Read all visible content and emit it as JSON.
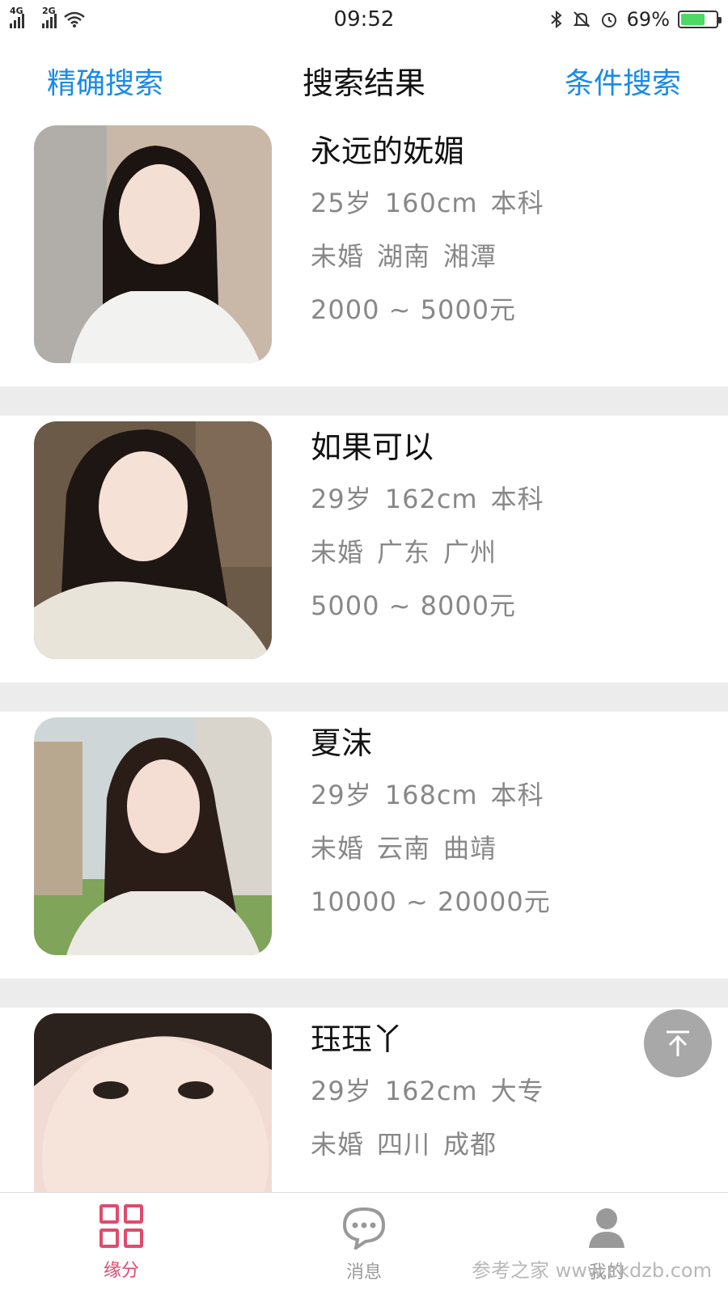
{
  "status_bar": {
    "network1": "4G",
    "network2": "2G",
    "time": "09:52",
    "battery": "69%",
    "battery_level": 0.69
  },
  "nav": {
    "left": "精确搜索",
    "title": "搜索结果",
    "right": "条件搜索"
  },
  "profiles": [
    {
      "name": "永远的妩媚",
      "age": "25岁",
      "height": "160cm",
      "edu": "本科",
      "marital": "未婚",
      "province": "湖南",
      "city": "湘潭",
      "income": "2000 ~ 5000元",
      "photo_bg": "#c9b8a8",
      "hair": "#1b1411",
      "shirt": "#f2f2f0"
    },
    {
      "name": "如果可以",
      "age": "29岁",
      "height": "162cm",
      "edu": "本科",
      "marital": "未婚",
      "province": "广东",
      "city": "广州",
      "income": "5000 ~ 8000元",
      "photo_bg": "#6b5a48",
      "hair": "#1e1612",
      "shirt": "#e9e4da"
    },
    {
      "name": "夏沫",
      "age": "29岁",
      "height": "168cm",
      "edu": "本科",
      "marital": "未婚",
      "province": "云南",
      "city": "曲靖",
      "income": "10000 ~ 20000元",
      "photo_bg": "#cfd6d8",
      "hair": "#2a1d17",
      "shirt": "#ece9e4"
    },
    {
      "name": "珏珏丫",
      "age": "29岁",
      "height": "162cm",
      "edu": "大专",
      "marital": "未婚",
      "province": "四川",
      "city": "成都",
      "income": "",
      "photo_bg": "#f0dcd2",
      "hair": "#2b211d",
      "shirt": "#f1e0d8"
    }
  ],
  "tabs": [
    {
      "label": "缘分",
      "icon": "grid-icon",
      "active": true
    },
    {
      "label": "消息",
      "icon": "chat-bubble-icon",
      "active": false
    },
    {
      "label": "我的",
      "icon": "user-icon",
      "active": false
    }
  ],
  "watermark": "参考之家 www.ckdzb.com",
  "colors": {
    "accent_blue": "#1a8ae8",
    "active_pink": "#e04a6e",
    "secondary_text": "#888888",
    "separator": "#ececec"
  }
}
